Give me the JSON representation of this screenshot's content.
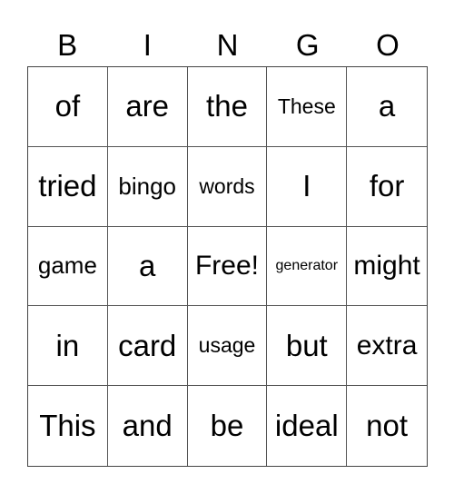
{
  "header": [
    "B",
    "I",
    "N",
    "G",
    "O"
  ],
  "cells": [
    {
      "text": "of",
      "size": "s-xl"
    },
    {
      "text": "are",
      "size": "s-xl"
    },
    {
      "text": "the",
      "size": "s-xl"
    },
    {
      "text": "These",
      "size": "s-s"
    },
    {
      "text": "a",
      "size": "s-xl"
    },
    {
      "text": "tried",
      "size": "s-xl"
    },
    {
      "text": "bingo",
      "size": "s-m"
    },
    {
      "text": "words",
      "size": "s-s"
    },
    {
      "text": "I",
      "size": "s-xl"
    },
    {
      "text": "for",
      "size": "s-xl"
    },
    {
      "text": "game",
      "size": "s-m"
    },
    {
      "text": "a",
      "size": "s-xl"
    },
    {
      "text": "Free!",
      "size": "s-l"
    },
    {
      "text": "generator",
      "size": "s-xs"
    },
    {
      "text": "might",
      "size": "s-l"
    },
    {
      "text": "in",
      "size": "s-xl"
    },
    {
      "text": "card",
      "size": "s-xl"
    },
    {
      "text": "usage",
      "size": "s-s"
    },
    {
      "text": "but",
      "size": "s-xl"
    },
    {
      "text": "extra",
      "size": "s-l"
    },
    {
      "text": "This",
      "size": "s-xl"
    },
    {
      "text": "and",
      "size": "s-xl"
    },
    {
      "text": "be",
      "size": "s-xl"
    },
    {
      "text": "ideal",
      "size": "s-xl"
    },
    {
      "text": "not",
      "size": "s-xl"
    }
  ]
}
